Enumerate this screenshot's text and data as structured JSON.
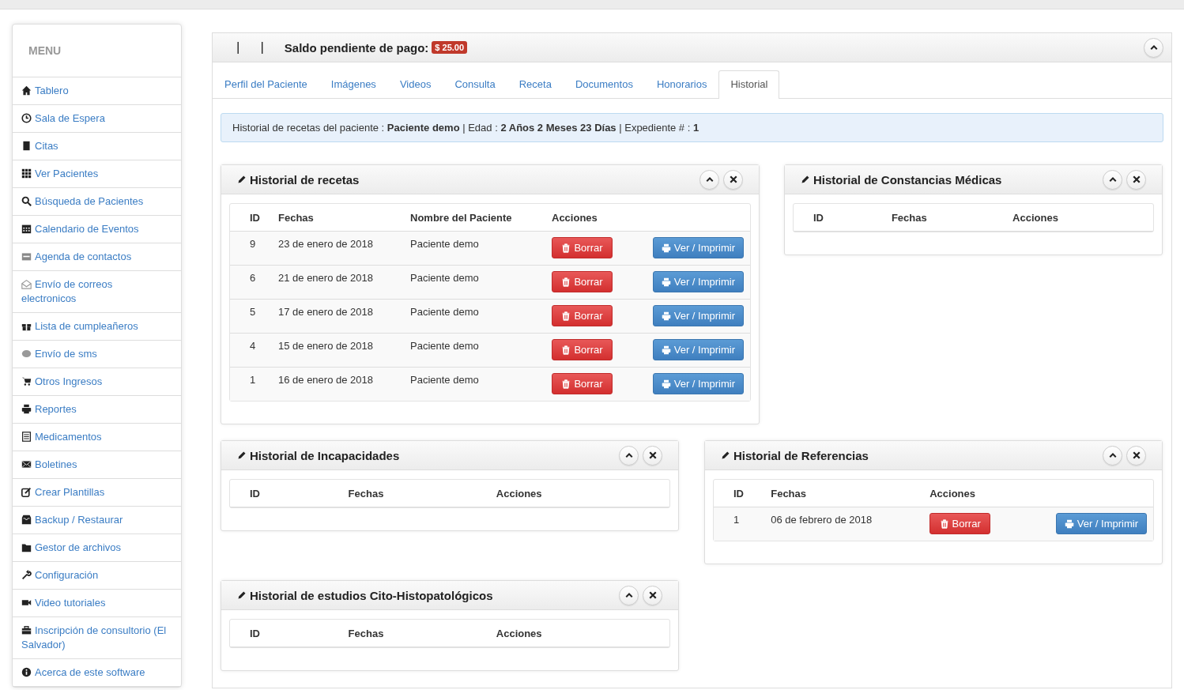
{
  "sidebar": {
    "title": "MENU",
    "items": [
      {
        "label": "Tablero"
      },
      {
        "label": "Sala de Espera"
      },
      {
        "label": "Citas"
      },
      {
        "label": "Ver Pacientes"
      },
      {
        "label": "Búsqueda de Pacientes"
      },
      {
        "label": "Calendario de Eventos"
      },
      {
        "label": "Agenda de contactos"
      },
      {
        "label": "Envío de correos electronicos"
      },
      {
        "label": "Lista de cumpleañeros"
      },
      {
        "label": "Envío de sms"
      },
      {
        "label": "Otros Ingresos"
      },
      {
        "label": "Reportes"
      },
      {
        "label": "Medicamentos"
      },
      {
        "label": "Boletines"
      },
      {
        "label": "Crear Plantillas"
      },
      {
        "label": "Backup / Restaurar"
      },
      {
        "label": "Gestor de archivos"
      },
      {
        "label": "Configuración"
      },
      {
        "label": "Video tutoriales"
      },
      {
        "label": "Inscripción de consultorio (El Salvador)"
      },
      {
        "label": "Acerca de este software"
      }
    ]
  },
  "header": {
    "separators": [
      "|",
      "|"
    ],
    "title": "Saldo pendiente de pago:",
    "balance": "$ 25.00"
  },
  "tabs": [
    {
      "label": "Perfil del Paciente",
      "selected": false
    },
    {
      "label": "Imágenes",
      "selected": false
    },
    {
      "label": "Videos",
      "selected": false
    },
    {
      "label": "Consulta",
      "selected": false
    },
    {
      "label": "Receta",
      "selected": false
    },
    {
      "label": "Documentos",
      "selected": false
    },
    {
      "label": "Honorarios",
      "selected": false
    },
    {
      "label": "Historial",
      "selected": true
    }
  ],
  "info": "Historial de recetas del paciente : **Paciente demo** | Edad : **2 Años 2 Meses 23 Días** | Expediente # : **1**",
  "widgets": [
    {
      "title": "Historial de recetas",
      "columns": [
        "ID",
        "Fechas",
        "Nombre del Paciente",
        "Acciones"
      ],
      "rows": [
        {
          "cells": [
            "9",
            "23 de enero de 2018",
            "Paciente demo"
          ],
          "delete": "Borrar",
          "view": "Ver / Imprimir"
        },
        {
          "cells": [
            "6",
            "21 de enero de 2018",
            "Paciente demo"
          ],
          "delete": "Borrar",
          "view": "Ver / Imprimir"
        },
        {
          "cells": [
            "5",
            "17 de enero de 2018",
            "Paciente demo"
          ],
          "delete": "Borrar",
          "view": "Ver / Imprimir"
        },
        {
          "cells": [
            "4",
            "15 de enero de 2018",
            "Paciente demo"
          ],
          "delete": "Borrar",
          "view": "Ver / Imprimir"
        },
        {
          "cells": [
            "1",
            "16 de enero de 2018",
            "Paciente demo"
          ],
          "delete": "Borrar",
          "view": "Ver / Imprimir"
        }
      ]
    },
    {
      "title": "Historial de Constancias Médicas",
      "columns": [
        "ID",
        "Fechas",
        "Acciones"
      ]
    },
    {
      "title": "Historial de Incapacidades",
      "columns": [
        "ID",
        "Fechas",
        "Acciones"
      ]
    },
    {
      "title": "Historial de Referencias",
      "columns": [
        "ID",
        "Fechas",
        "Acciones"
      ],
      "rows": [
        {
          "cells": [
            "1",
            "06 de febrero de 2018"
          ],
          "delete": "Borrar",
          "view": "Ver / Imprimir"
        }
      ]
    },
    {
      "title": "Historial de estudios Cito-Histopatológicos",
      "columns": [
        "ID",
        "Fechas",
        "Acciones"
      ]
    }
  ]
}
